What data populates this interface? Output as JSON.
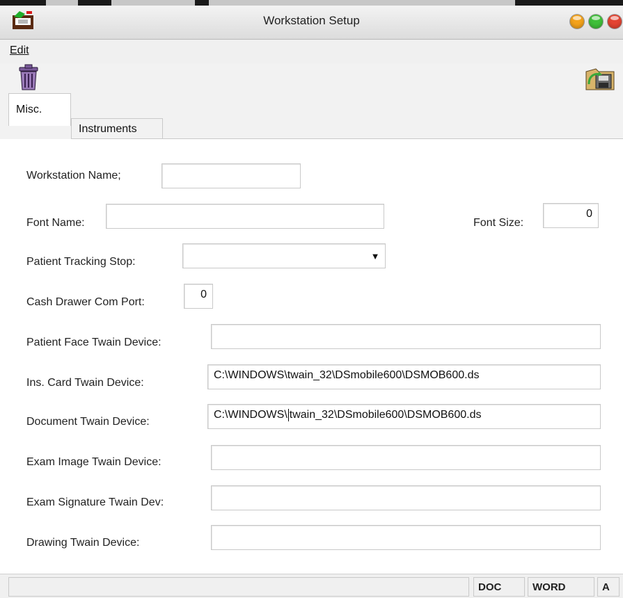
{
  "window": {
    "title": "Workstation Setup",
    "controls": {
      "minimize_color": "#f3a21b",
      "zoom_color": "#3fbf3a",
      "close_color": "#e34432"
    }
  },
  "menu": {
    "items": [
      {
        "label": "Edit"
      }
    ]
  },
  "toolbar": {
    "delete_icon": "trash-icon",
    "save_icon": "save-folder-icon"
  },
  "tabs": [
    {
      "label": "Misc.",
      "active": true
    },
    {
      "label": "Instruments",
      "active": false
    }
  ],
  "form": {
    "workstation_name": {
      "label": "Workstation Name;",
      "value": ""
    },
    "font_name": {
      "label": "Font Name:",
      "value": ""
    },
    "font_size": {
      "label": "Font Size:",
      "value": "0"
    },
    "patient_tracking_stop": {
      "label": "Patient Tracking Stop:",
      "value": ""
    },
    "cash_drawer_com_port": {
      "label": "Cash Drawer Com Port:",
      "value": "0"
    },
    "patient_face_twain": {
      "label": "Patient Face Twain Device:",
      "value": ""
    },
    "ins_card_twain": {
      "label": "Ins. Card Twain Device:",
      "value": "C:\\WINDOWS\\twain_32\\DSmobile600\\DSMOB600.ds"
    },
    "document_twain": {
      "label": "Document Twain Device:",
      "value_before_cursor": "C:\\WINDOWS\\",
      "value_after_cursor": "twain_32\\DSmobile600\\DSMOB600.ds"
    },
    "exam_image_twain": {
      "label": "Exam Image Twain Device:",
      "value": ""
    },
    "exam_signature_twain": {
      "label": "Exam Signature Twain Dev:",
      "value": ""
    },
    "drawing_twain": {
      "label": "Drawing Twain Device:",
      "value": ""
    }
  },
  "status": {
    "doc": "DOC",
    "word": "WORD",
    "a": "A"
  }
}
